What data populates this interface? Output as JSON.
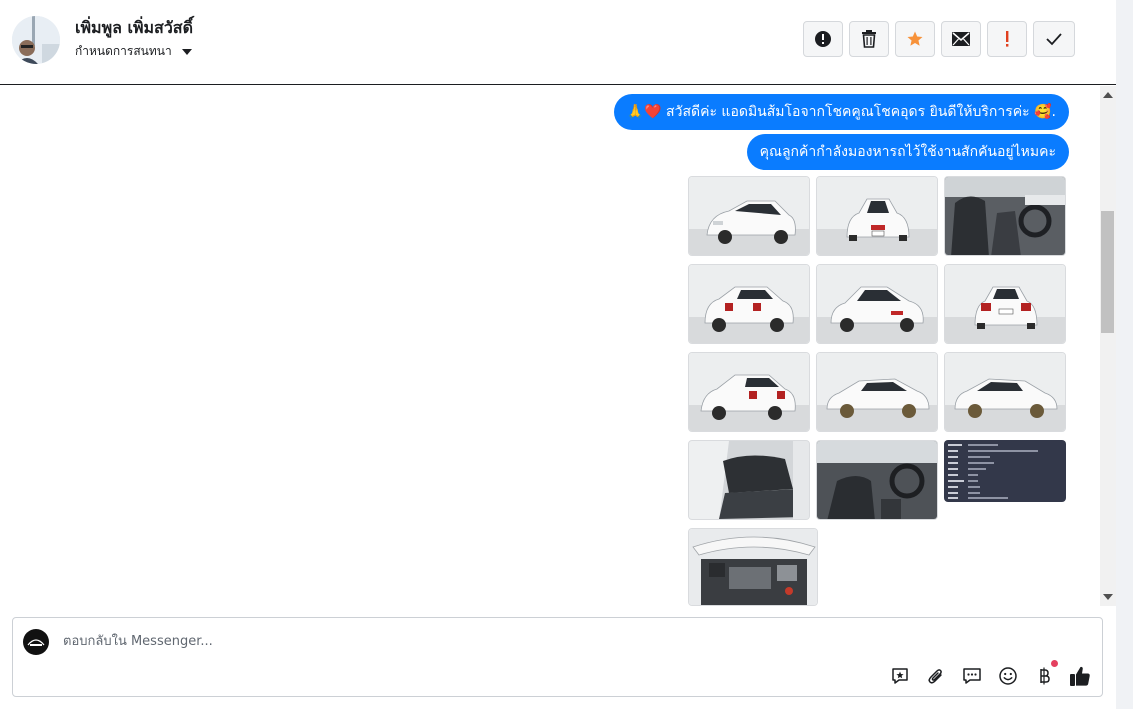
{
  "header": {
    "contact_name": "เพิ่มพูล เพิ่มสวัสดิ์",
    "assign_label": "กำหนดการสนทนา"
  },
  "actions": [
    {
      "name": "spam-button",
      "icon": "alert-circle-icon"
    },
    {
      "name": "delete-button",
      "icon": "trash-icon"
    },
    {
      "name": "star-button",
      "icon": "star-icon",
      "color": "#f7923a"
    },
    {
      "name": "mark-unread-button",
      "icon": "envelope-icon"
    },
    {
      "name": "follow-up-button",
      "icon": "exclamation-icon",
      "color": "#e0401f"
    },
    {
      "name": "done-button",
      "icon": "check-icon"
    }
  ],
  "messages": [
    {
      "text": "🙏❤️ สวัสดีค่ะ แอดมินส้มโอจากโชคคูณโชคอุดร ยินดีให้บริการค่ะ 🥰.",
      "from": "page"
    },
    {
      "text": "คุณลูกค้ากำลังมองหารถไว้ใช้งานสักคันอยู่ไหมคะ",
      "from": "page"
    }
  ],
  "attachments": [
    {
      "subject": "white-hatchback-front-left"
    },
    {
      "subject": "white-hatchback-front"
    },
    {
      "subject": "interior-driver-seat"
    },
    {
      "subject": "white-hatchback-rear-left"
    },
    {
      "subject": "white-hatchback-front-right"
    },
    {
      "subject": "white-hatchback-rear"
    },
    {
      "subject": "white-hatchback-rear-right"
    },
    {
      "subject": "white-hatchback-side-right"
    },
    {
      "subject": "white-hatchback-side-left"
    },
    {
      "subject": "interior-rear-seats"
    },
    {
      "subject": "interior-dashboard"
    },
    {
      "subject": "vehicle-registration-document"
    },
    {
      "subject": "engine-bay"
    }
  ],
  "composer": {
    "placeholder": "ตอบกลับใน Messenger..."
  },
  "composer_tools": [
    {
      "name": "saved-reply-icon"
    },
    {
      "name": "attach-icon"
    },
    {
      "name": "message-bubble-icon"
    },
    {
      "name": "emoji-icon"
    },
    {
      "name": "baht-payment-icon",
      "has_notification": true
    },
    {
      "name": "like-icon"
    }
  ],
  "colors": {
    "accent": "#0a7cff",
    "star": "#f7923a",
    "follow_up": "#e0401f",
    "notification": "#e4405f"
  }
}
